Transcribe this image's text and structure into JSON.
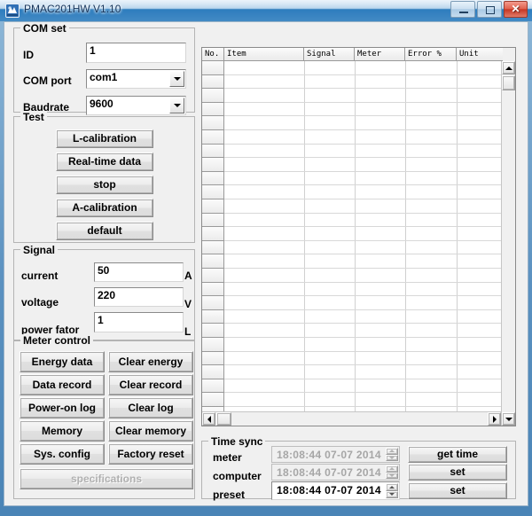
{
  "window": {
    "title": "PMAC201HW V1.10",
    "icon": "app-icon",
    "minimize_label": "",
    "maximize_label": "",
    "close_label": "✕"
  },
  "com_set": {
    "legend": "COM set",
    "id_label": "ID",
    "id_value": "1",
    "com_port_label": "COM port",
    "com_port_value": "com1",
    "baudrate_label": "Baudrate",
    "baudrate_value": "9600"
  },
  "test": {
    "legend": "Test",
    "buttons": [
      {
        "label": "L-calibration",
        "disabled": false
      },
      {
        "label": "Real-time data",
        "disabled": false
      },
      {
        "label": "stop",
        "disabled": false
      },
      {
        "label": "A-calibration",
        "disabled": false
      },
      {
        "label": "default",
        "disabled": false
      }
    ]
  },
  "signal": {
    "legend": "Signal",
    "rows": [
      {
        "label": "current",
        "value": "50",
        "unit": "A"
      },
      {
        "label": "voltage",
        "value": "220",
        "unit": "V"
      },
      {
        "label": "power fator",
        "value": "1",
        "unit": "L"
      }
    ]
  },
  "meter_control": {
    "legend": "Meter control",
    "left_buttons": [
      {
        "label": "Energy data",
        "disabled": false
      },
      {
        "label": "Data record",
        "disabled": false
      },
      {
        "label": "Power-on log",
        "disabled": false
      },
      {
        "label": "Memory",
        "disabled": false
      },
      {
        "label": "Sys. config",
        "disabled": false
      }
    ],
    "right_buttons": [
      {
        "label": "Clear energy",
        "disabled": false
      },
      {
        "label": "Clear record",
        "disabled": false
      },
      {
        "label": "Clear log",
        "disabled": false
      },
      {
        "label": "Clear memory",
        "disabled": false
      },
      {
        "label": "Factory reset",
        "disabled": false
      }
    ],
    "wide_button": {
      "label": "specifications",
      "disabled": true
    }
  },
  "grid": {
    "columns": [
      "No.",
      "Item",
      "Signal",
      "Meter",
      "Error %",
      "Unit"
    ],
    "rows": [],
    "visible_row_count": 26,
    "scroll_up_icon": "triangle-up-icon",
    "scroll_down_icon": "triangle-down-icon",
    "scroll_left_icon": "triangle-left-icon",
    "scroll_right_icon": "triangle-right-icon"
  },
  "time_sync": {
    "legend": "Time sync",
    "rows": [
      {
        "label": "meter",
        "value": "18:08:44  07-07  2014",
        "disabled": true,
        "action": "get time"
      },
      {
        "label": "computer",
        "value": "18:08:44  07-07  2014",
        "disabled": true,
        "action": "set"
      },
      {
        "label": "preset",
        "value": "18:08:44  07-07  2014",
        "disabled": false,
        "action": "set"
      }
    ]
  },
  "colors": {
    "titlebar_accent": "#2e7dbe",
    "window_border": "#6f9ec4",
    "client_bg": "#f0f0f0",
    "close_button": "#c63422",
    "disabled_text": "#b0b0b0"
  }
}
